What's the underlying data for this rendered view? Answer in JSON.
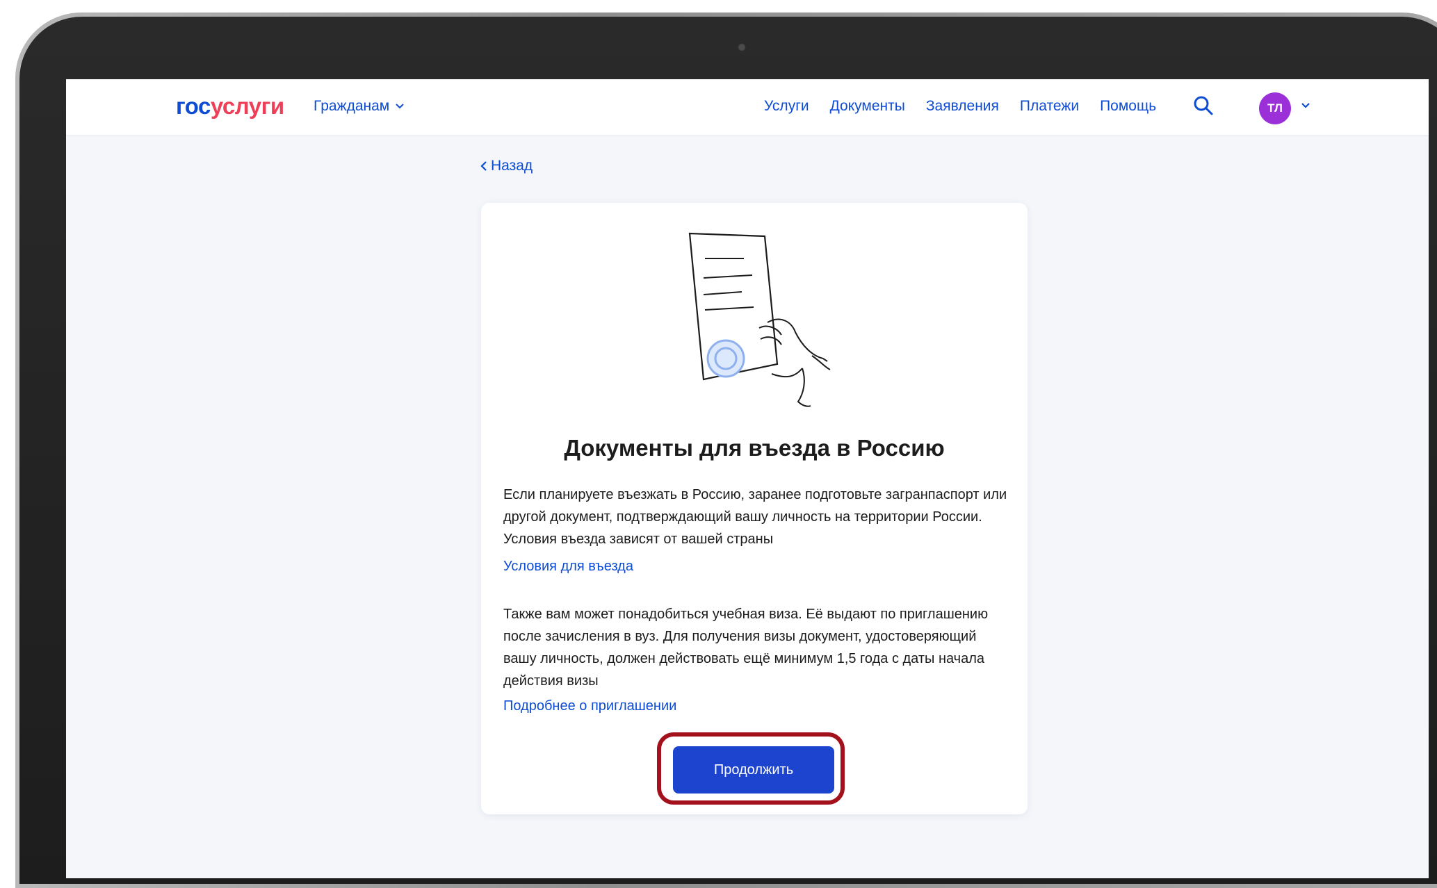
{
  "header": {
    "logo_part1": "гос",
    "logo_part2": "услуги",
    "citizens_label": "Гражданам",
    "nav": [
      "Услуги",
      "Документы",
      "Заявления",
      "Платежи",
      "Помощь"
    ],
    "avatar_initials": "ТЛ"
  },
  "back_label": "Назад",
  "card": {
    "title": "Документы для въезда в Россию",
    "paragraph1": "Если планируете въезжать в Россию, заранее подготовьте загранпаспорт или другой документ, подтверждающий вашу личность на территории России. Условия въезда зависят от вашей страны",
    "link1": "Условия для въезда",
    "paragraph2": "Также вам может понадобиться учебная виза. Её выдают по приглашению после зачисления в вуз. Для получения визы документ, удостоверяющий вашу личность, должен действовать ещё минимум 1,5 года с даты начала действия визы",
    "link2": "Подробнее о приглашении",
    "continue_label": "Продолжить"
  },
  "colors": {
    "brand_blue": "#0d4cd3",
    "brand_red": "#ee3f58",
    "button_blue": "#1d44cf",
    "highlight_red": "#a3111d",
    "avatar_purple": "#9b30d9"
  }
}
